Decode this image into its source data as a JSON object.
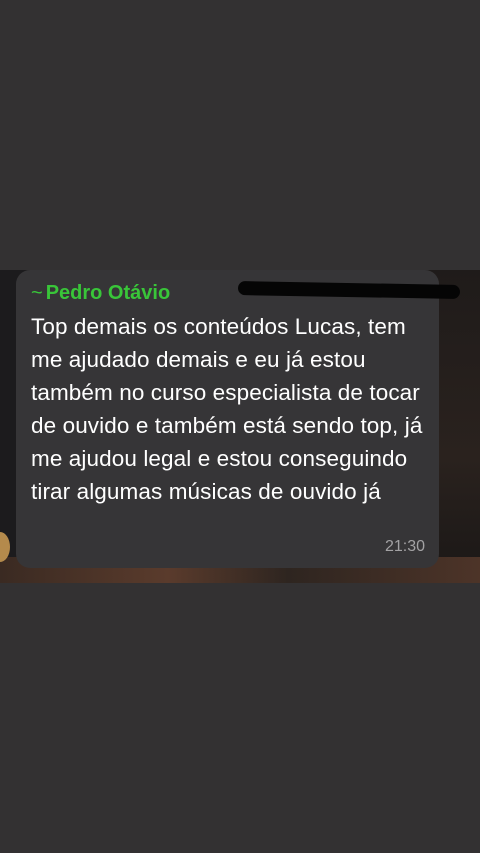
{
  "chat": {
    "sender_prefix": "~",
    "sender_name": "Pedro Otávio",
    "message_text": "Top demais os conteúdos Lucas, tem me ajudado demais e eu já estou também no curso especialista de tocar de ouvido e também está sendo top, já me ajudou legal e estou conseguindo tirar algumas músicas de ouvido já",
    "time": "21:30"
  },
  "colors": {
    "sender_name": "#39c539",
    "bubble_background": "#363537",
    "page_background": "#333132",
    "message_text": "#ffffff",
    "timestamp": "#a3a2a4"
  }
}
